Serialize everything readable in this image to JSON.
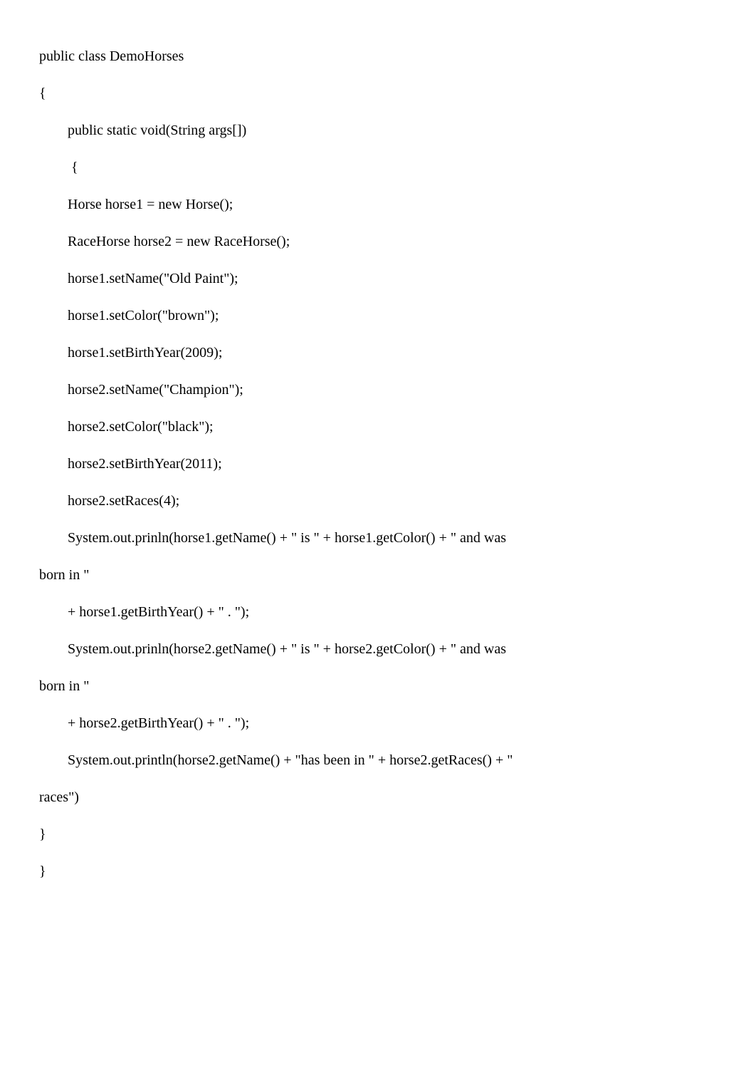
{
  "code": {
    "line01": "public class DemoHorses",
    "line02": "{",
    "line03": "        public static void(String args[])",
    "line04": "         {",
    "line05": "        Horse horse1 = new Horse();",
    "line06": "        RaceHorse horse2 = new RaceHorse();",
    "line07": "        horse1.setName(\"Old Paint\");",
    "line08": "        horse1.setColor(\"brown\");",
    "line09": "        horse1.setBirthYear(2009);",
    "line10": "        horse2.setName(\"Champion\");",
    "line11": "        horse2.setColor(\"black\");",
    "line12": "        horse2.setBirthYear(2011);",
    "line13": "        horse2.setRaces(4);",
    "line14": "        System.out.prinln(horse1.getName() + \" is \" + horse1.getColor() + \" and was",
    "line15": "born in \"",
    "line16": "        + horse1.getBirthYear() + \" . \");",
    "line17": "        System.out.prinln(horse2.getName() + \" is \" + horse2.getColor() + \" and was",
    "line18": "born in \"",
    "line19": "        + horse2.getBirthYear() + \" . \");",
    "line20": "        System.out.println(horse2.getName() + \"has been in \" + horse2.getRaces() + \"",
    "line21": "races\")",
    "line22": "}",
    "line23": "}"
  }
}
